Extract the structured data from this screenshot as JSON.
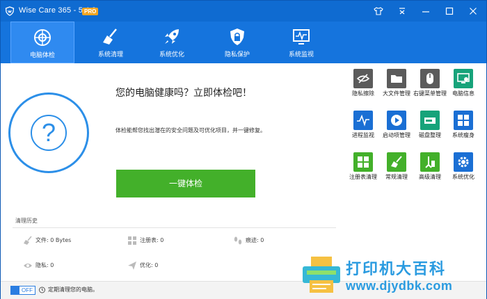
{
  "window": {
    "title": "Wise Care 365 - 5.4.8",
    "badge": "PRO"
  },
  "nav": [
    {
      "label": "电脑体检",
      "icon": "checkup-icon",
      "active": true
    },
    {
      "label": "系统清理",
      "icon": "broom-icon"
    },
    {
      "label": "系统优化",
      "icon": "rocket-icon"
    },
    {
      "label": "隐私保护",
      "icon": "lock-shield-icon"
    },
    {
      "label": "系统监视",
      "icon": "monitor-pulse-icon"
    }
  ],
  "main": {
    "headline": "您的电脑健康吗？立即体检吧！",
    "description": "体检能帮您找出潜在的安全问题及可优化项目，并一键修复。",
    "checkup_button": "一键体检",
    "circle_symbol": "?"
  },
  "history": {
    "title": "清理历史",
    "items": [
      {
        "label": "文件: 0 Bytes",
        "icon": "broom-icon"
      },
      {
        "label": "注册表: 0",
        "icon": "grid-icon"
      },
      {
        "label": "痕迹: 0",
        "icon": "footprint-icon"
      },
      {
        "label": "隐私: 0",
        "icon": "eye-icon"
      },
      {
        "label": "优化: 0",
        "icon": "plane-icon"
      }
    ]
  },
  "tools": [
    {
      "label": "隐私擦除",
      "color": "#5b5b5b",
      "icon": "eye-off-icon"
    },
    {
      "label": "大文件管理",
      "color": "#5b5b5b",
      "icon": "folder-icon"
    },
    {
      "label": "右键菜单管理",
      "color": "#5b5b5b",
      "icon": "mouse-icon"
    },
    {
      "label": "电脑信息",
      "color": "#17a37a",
      "icon": "pc-info-icon"
    },
    {
      "label": "进程监视",
      "color": "#1a6fd4",
      "icon": "pulse-icon"
    },
    {
      "label": "启动项管理",
      "color": "#1a6fd4",
      "icon": "play-icon"
    },
    {
      "label": "磁盘整理",
      "color": "#17a37a",
      "icon": "disk-icon"
    },
    {
      "label": "系统瘦身",
      "color": "#1a6fd4",
      "icon": "windows-icon"
    },
    {
      "label": "注册表清理",
      "color": "#43b02a",
      "icon": "registry-grid-icon"
    },
    {
      "label": "常规清理",
      "color": "#43b02a",
      "icon": "broom-icon"
    },
    {
      "label": "高级清理",
      "color": "#43b02a",
      "icon": "advanced-clean-icon"
    },
    {
      "label": "系统优化",
      "color": "#1a6fd4",
      "icon": "gear-icon"
    }
  ],
  "footer": {
    "toggle": "OFF",
    "schedule_text": "定期清理您的电脑。"
  },
  "watermark": {
    "cn": "打印机大百科",
    "url": "www.djydbk.com"
  }
}
